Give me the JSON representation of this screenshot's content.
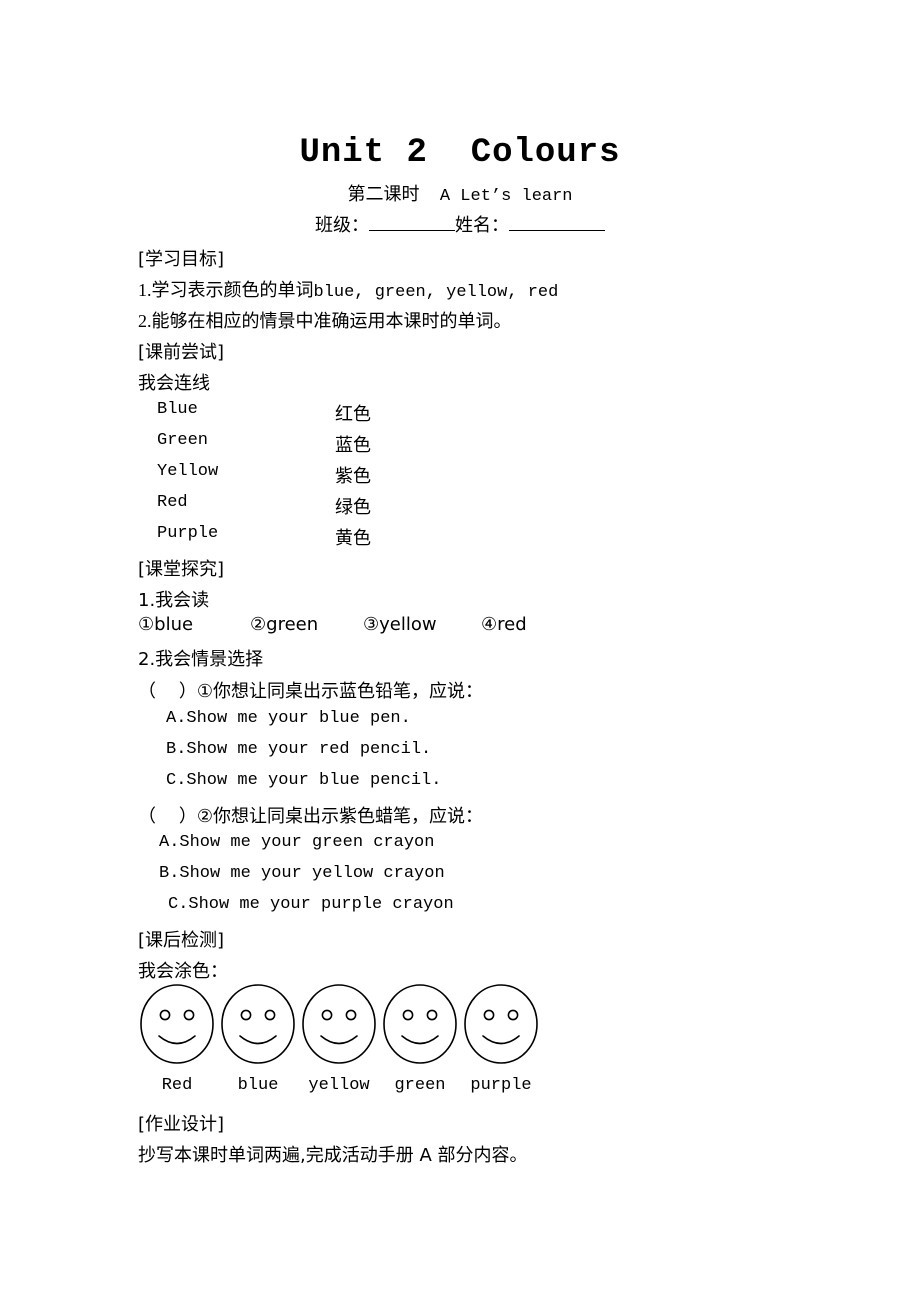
{
  "header": {
    "title": "Unit 2  Colours",
    "subtitle_cn": "第二课时",
    "subtitle_en": "A Let’s learn",
    "class_label": "班级：",
    "name_label": "姓名："
  },
  "sections": {
    "objectives": {
      "heading": "[学习目标]",
      "items": [
        {
          "num": "1.",
          "cn": "学习表示颜色的单词",
          "en": "blue, green, yellow, red"
        },
        {
          "num": "2.",
          "cn": "能够在相应的情景中准确运用本课时的单词。",
          "en": ""
        }
      ]
    },
    "pre_class": {
      "heading": "[课前尝试]",
      "task": "我会连线",
      "pairs": [
        {
          "en": "Blue",
          "cn": "红色"
        },
        {
          "en": "Green",
          "cn": "蓝色"
        },
        {
          "en": "Yellow",
          "cn": "紫色"
        },
        {
          "en": "Red",
          "cn": "绿色"
        },
        {
          "en": "Purple",
          "cn": "黄色"
        }
      ]
    },
    "in_class": {
      "heading": "[课堂探究]",
      "task1_title": "1.我会读",
      "read_words": [
        "①blue",
        "②green",
        "③yellow",
        "④red"
      ],
      "task2_title": "2.我会情景选择",
      "questions": [
        {
          "stem": "（    ）①你想让同桌出示蓝色铅笔，应说：",
          "options": [
            "A.Show me your blue pen.",
            "B.Show me your red pencil.",
            "C.Show me your blue pencil."
          ]
        },
        {
          "stem": "（    ）②你想让同桌出示紫色蜡笔，应说：",
          "options": [
            "A.Show me your green crayon",
            "B.Show me your yellow crayon",
            "C.Show me your purple crayon"
          ]
        }
      ]
    },
    "post_class": {
      "heading": "[课后检测]",
      "task": "我会涂色：",
      "face_labels": [
        "Red",
        "blue",
        "yellow",
        "green",
        "purple"
      ]
    },
    "homework": {
      "heading": "[作业设计]",
      "text": "抄写本课时单词两遍,完成活动手册 A 部分内容。"
    }
  }
}
